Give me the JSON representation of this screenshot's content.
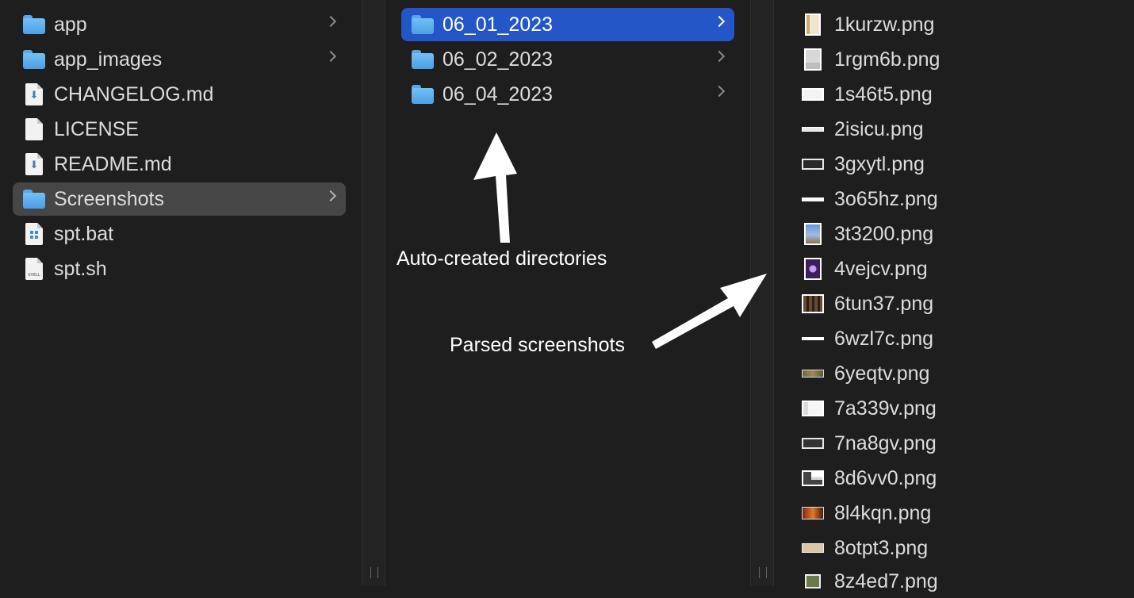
{
  "column1": {
    "items": [
      {
        "label": "app",
        "icon": "folder-icon"
      },
      {
        "label": "app_images",
        "icon": "folder-icon"
      },
      {
        "label": "CHANGELOG.md",
        "icon": "markdown-file-icon"
      },
      {
        "label": "LICENSE",
        "icon": "file-icon"
      },
      {
        "label": "README.md",
        "icon": "markdown-file-icon"
      },
      {
        "label": "Screenshots",
        "icon": "folder-icon",
        "selected": true
      },
      {
        "label": "spt.bat",
        "icon": "batch-file-icon"
      },
      {
        "label": "spt.sh",
        "icon": "shell-script-icon",
        "badge": "SHELL"
      }
    ]
  },
  "column2": {
    "items": [
      {
        "label": "06_01_2023",
        "icon": "folder-icon",
        "selected": true
      },
      {
        "label": "06_02_2023",
        "icon": "folder-icon"
      },
      {
        "label": "06_04_2023",
        "icon": "folder-icon"
      }
    ]
  },
  "column3": {
    "items": [
      {
        "label": "1kurzw.png"
      },
      {
        "label": "1rgm6b.png"
      },
      {
        "label": "1s46t5.png"
      },
      {
        "label": "2isicu.png"
      },
      {
        "label": "3gxytl.png"
      },
      {
        "label": "3o65hz.png"
      },
      {
        "label": "3t3200.png"
      },
      {
        "label": "4vejcv.png"
      },
      {
        "label": "6tun37.png"
      },
      {
        "label": "6wzl7c.png"
      },
      {
        "label": "6yeqtv.png"
      },
      {
        "label": "7a339v.png"
      },
      {
        "label": "7na8gv.png"
      },
      {
        "label": "8d6vv0.png"
      },
      {
        "label": "8l4kqn.png"
      },
      {
        "label": "8otpt3.png"
      },
      {
        "label": "8z4ed7.png"
      }
    ]
  },
  "annotations": {
    "directories": "Auto-created directories",
    "screenshots": "Parsed screenshots"
  },
  "colors": {
    "background": "#1e1e1e",
    "selected_blue": "#2456c8",
    "selected_gray": "#464646",
    "folder_blue": "#5aa6e6",
    "arrow": "#ffffff"
  }
}
